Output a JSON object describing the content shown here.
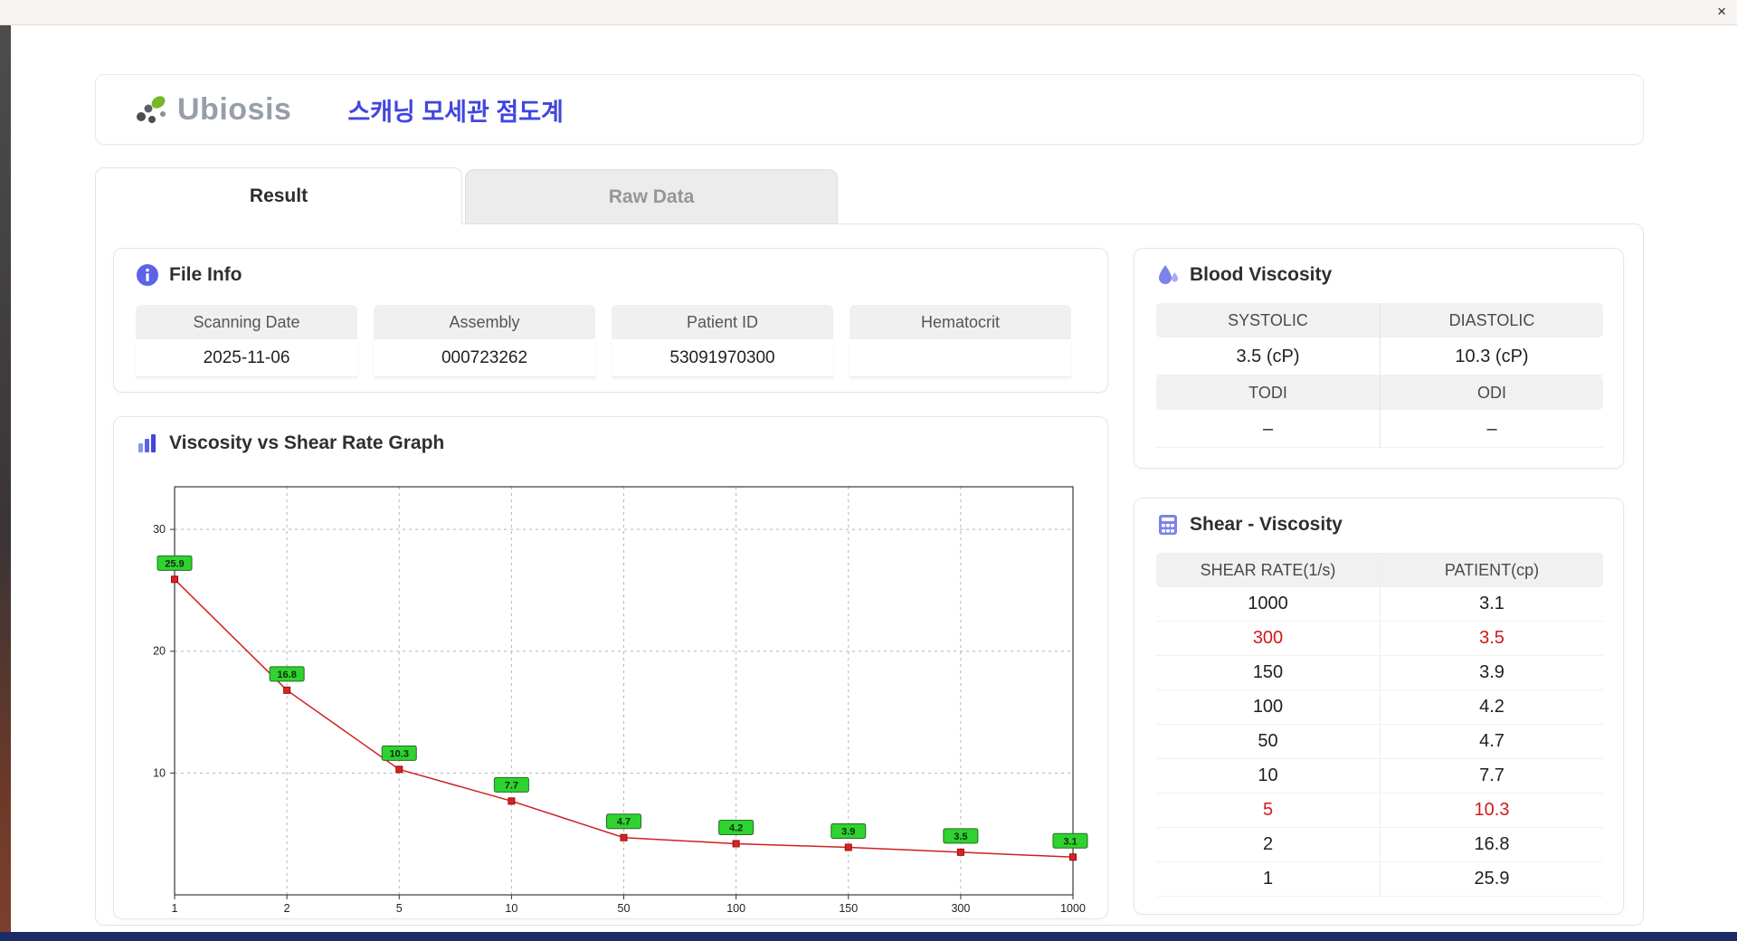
{
  "window": {
    "close_label": "×"
  },
  "header": {
    "logo_text": "Ubiosis",
    "title": "스캐닝 모세관 점도계"
  },
  "tabs": [
    {
      "label": "Result"
    },
    {
      "label": "Raw Data"
    }
  ],
  "file_info": {
    "title": "File Info",
    "fields": [
      {
        "label": "Scanning Date",
        "value": "2025-11-06"
      },
      {
        "label": "Assembly",
        "value": "000723262"
      },
      {
        "label": "Patient ID",
        "value": "53091970300"
      },
      {
        "label": "Hematocrit",
        "value": ""
      }
    ]
  },
  "graph": {
    "title": "Viscosity vs Shear Rate Graph"
  },
  "chart_data": {
    "type": "line",
    "title": "Viscosity vs Shear Rate Graph",
    "x_labels": [
      "1",
      "2",
      "5",
      "10",
      "50",
      "100",
      "150",
      "300",
      "1000"
    ],
    "series": [
      {
        "name": "Patient",
        "values": [
          25.9,
          16.8,
          10.3,
          7.7,
          4.7,
          4.2,
          3.9,
          3.5,
          3.1
        ]
      }
    ],
    "y_ticks": [
      10,
      20,
      30
    ],
    "ylim": [
      0,
      33.5
    ],
    "grid": "dashed",
    "legend": "none",
    "line_color": "#cf2020",
    "marker_color": "#e02020",
    "marker_stroke": "#8f0f0f",
    "label_bg": "#2fd32f",
    "label_stroke": "#256b25"
  },
  "blood_viscosity": {
    "title": "Blood Viscosity",
    "rows": [
      {
        "labels": [
          "SYSTOLIC",
          "DIASTOLIC"
        ],
        "values": [
          "3.5 (cP)",
          "10.3 (cP)"
        ]
      },
      {
        "labels": [
          "TODI",
          "ODI"
        ],
        "values": [
          "–",
          "–"
        ]
      }
    ]
  },
  "shear_table": {
    "title": "Shear - Viscosity",
    "columns": [
      "SHEAR RATE(1/s)",
      "PATIENT(cp)"
    ],
    "rows": [
      {
        "shear": "1000",
        "patient": "3.1",
        "highlight": false
      },
      {
        "shear": "300",
        "patient": "3.5",
        "highlight": true
      },
      {
        "shear": "150",
        "patient": "3.9",
        "highlight": false
      },
      {
        "shear": "100",
        "patient": "4.2",
        "highlight": false
      },
      {
        "shear": "50",
        "patient": "4.7",
        "highlight": false
      },
      {
        "shear": "10",
        "patient": "7.7",
        "highlight": false
      },
      {
        "shear": "5",
        "patient": "10.3",
        "highlight": true
      },
      {
        "shear": "2",
        "patient": "16.8",
        "highlight": false
      },
      {
        "shear": "1",
        "patient": "25.9",
        "highlight": false
      }
    ]
  }
}
